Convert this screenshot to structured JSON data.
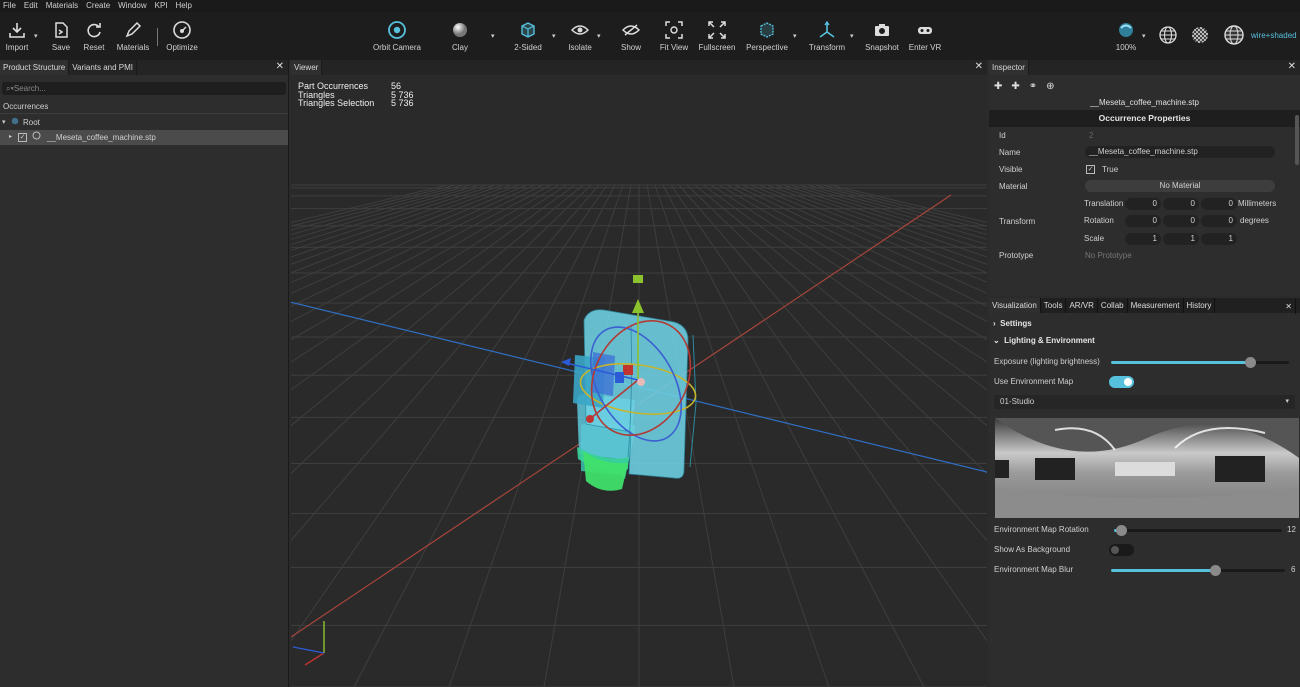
{
  "menu": [
    "File",
    "Edit",
    "Materials",
    "Create",
    "Window",
    "KPI",
    "Help"
  ],
  "toolbar": {
    "import": "Import",
    "save": "Save",
    "reset": "Reset",
    "materials": "Materials",
    "optimize": "Optimize",
    "orbit": "Orbit Camera",
    "clay": "Clay",
    "two_sided": "2-Sided",
    "isolate": "Isolate",
    "show": "Show",
    "fit_view": "Fit View",
    "fullscreen": "Fullscreen",
    "perspective": "Perspective",
    "transform": "Transform",
    "snapshot": "Snapshot",
    "enter_vr": "Enter VR",
    "zoom": "100%",
    "wire_mode": "wire+shaded"
  },
  "left_panel": {
    "tabs": [
      "Product Structure",
      "Variants and PMI"
    ],
    "search_placeholder": "Search...",
    "occurrences_label": "Occurrences",
    "root_label": "Root",
    "item_label": "__Meseta_coffee_machine.stp"
  },
  "viewer": {
    "tab": "Viewer",
    "stats": [
      {
        "label": "Part Occurrences",
        "value": "56"
      },
      {
        "label": "Triangles",
        "value": "5 736"
      },
      {
        "label": "Triangles Selection",
        "value": "5 736"
      }
    ]
  },
  "inspector": {
    "tab": "Inspector",
    "filename": "__Meseta_coffee_machine.stp",
    "section": "Occurrence Properties",
    "id_label": "Id",
    "id_value": "2",
    "name_label": "Name",
    "name_value": "__Meseta_coffee_machine.stp",
    "visible_label": "Visible",
    "visible_value": "True",
    "material_label": "Material",
    "material_value": "No Material",
    "transform_label": "Transform",
    "translation_label": "Translation",
    "translation": [
      "0",
      "0",
      "0"
    ],
    "translation_unit": "Millimeters",
    "rotation_label": "Rotation",
    "rotation": [
      "0",
      "0",
      "0"
    ],
    "rotation_unit": "degrees",
    "scale_label": "Scale",
    "scale": [
      "1",
      "1",
      "1"
    ],
    "prototype_label": "Prototype",
    "prototype_value": "No Prototype"
  },
  "visualization": {
    "tabs": [
      "Visualization",
      "Tools",
      "AR/VR",
      "Collab",
      "Measurement",
      "History"
    ],
    "settings": "Settings",
    "lighting": "Lighting & Environment",
    "exposure_label": "Exposure (lighting brightness)",
    "exposure_level": 0.78,
    "use_env_label": "Use Environment Map",
    "use_env_on": true,
    "env_map": "01-Studio",
    "env_rotation_label": "Environment Map Rotation",
    "env_rotation_value": "12",
    "env_rotation_level": 0.04,
    "show_bg_label": "Show As Background",
    "show_bg_on": false,
    "env_blur_label": "Environment Map Blur",
    "env_blur_value": "6",
    "env_blur_level": 0.6
  },
  "colors": {
    "accent": "#56c1dc"
  }
}
